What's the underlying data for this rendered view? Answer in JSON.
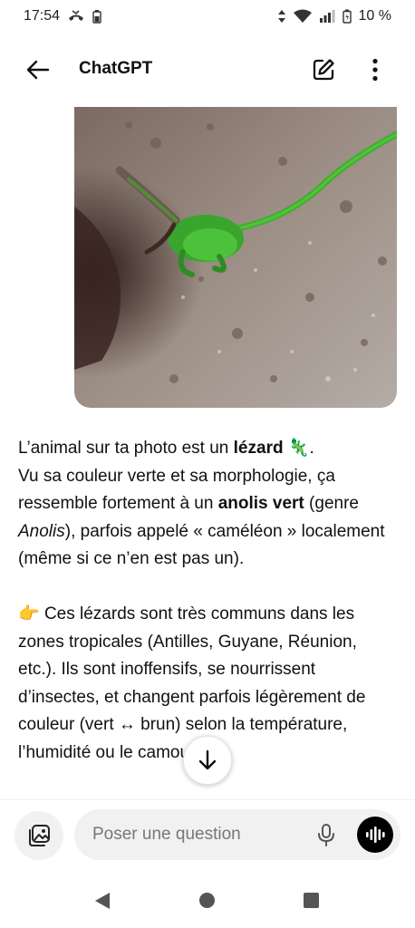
{
  "status_bar": {
    "time": "17:54",
    "battery_percent": "10 %",
    "icons": [
      "missed-call-icon",
      "battery-saver-icon",
      "data-arrows-icon",
      "wifi-icon",
      "signal-icon",
      "battery-icon"
    ]
  },
  "header": {
    "title": "ChatGPT",
    "back_icon": "arrow-left-icon",
    "edit_icon": "new-chat-pencil-icon",
    "more_icon": "more-vertical-icon"
  },
  "photo": {
    "subject": "green lizard on rough grey-brown surface"
  },
  "answer": {
    "p1_intro": "L’animal sur ta photo est un ",
    "p1_bold1": "lézard",
    "p1_emoji": "🦎",
    "p1_after_emoji": ".",
    "p1_line2": "Vu sa couleur verte et sa morphologie, ça ressemble fortement à un ",
    "p1_bold2": "anolis vert",
    "p1_genre_open": " (genre ",
    "p1_italic": "Anolis",
    "p1_genre_close": "), parfois appelé « caméléon » localement (même si ce n’en est pas un).",
    "p2_emoji": "👉",
    "p2_text": " Ces lézards sont très communs dans les zones tropicales (Antilles, Guyane, Réunion, etc.). Ils sont inoffensifs, se nourrissent d’insectes, et changent parfois légèrement de couleur (vert ↔ brun) selon la température, l’humidité ou le camouflage."
  },
  "composer": {
    "placeholder": "Poser une question",
    "attach_icon": "add-photo-icon",
    "mic_icon": "microphone-icon",
    "voice_icon": "voice-mode-icon"
  },
  "scroll_button_icon": "arrow-down-icon",
  "nav_bar": {
    "icons": [
      "nav-back-icon",
      "nav-home-icon",
      "nav-recents-icon"
    ]
  },
  "colors": {
    "lizard_green": "#3fae2f",
    "voice_button": "#000000",
    "pill_background": "#f1f1f1"
  }
}
